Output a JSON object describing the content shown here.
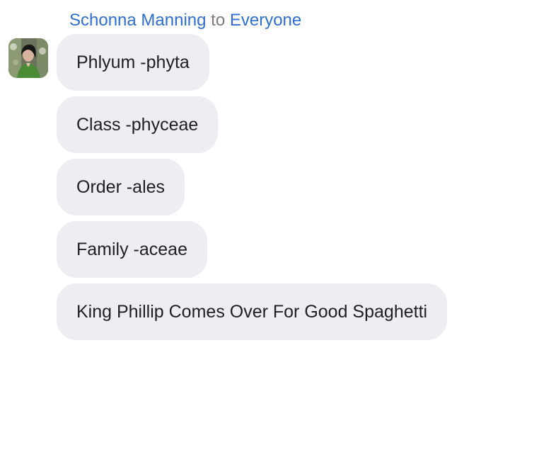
{
  "chat": {
    "sender_name": "Schonna Manning",
    "to_word": "to",
    "recipient": "Everyone",
    "avatar_icon": "user-photo-avatar",
    "messages": [
      "Phlyum -phyta",
      "Class -phyceae",
      "Order -ales",
      "Family -aceae",
      "King Phillip Comes Over For Good Spaghetti"
    ]
  },
  "colors": {
    "link": "#2f6fd3",
    "muted": "#7b7b80",
    "bubble_bg": "#eeeef2",
    "text": "#1f1f22"
  }
}
